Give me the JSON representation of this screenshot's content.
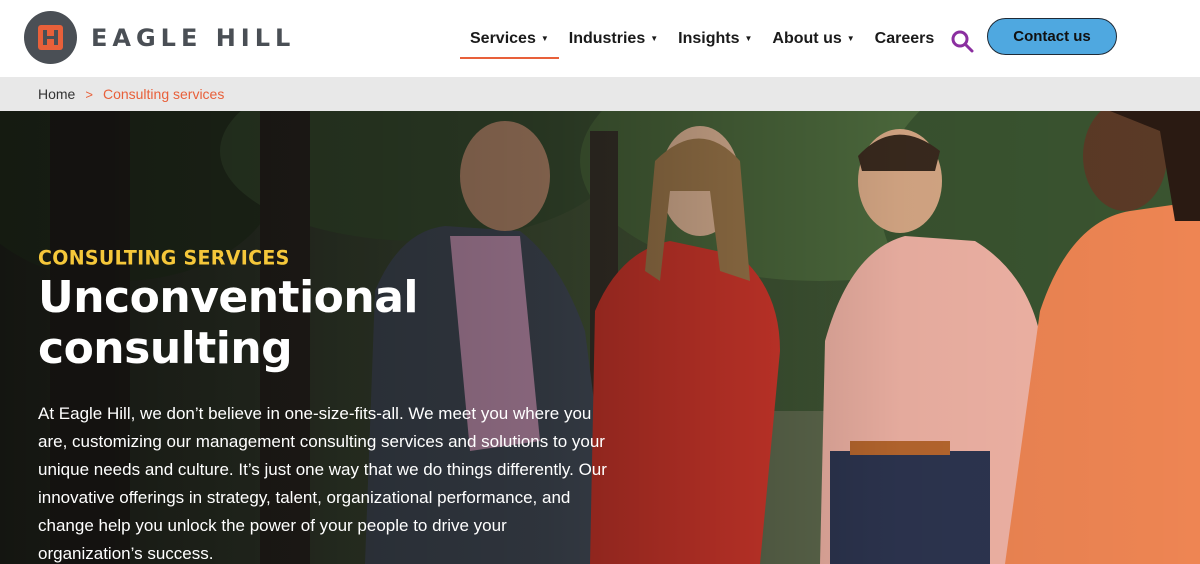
{
  "brand": {
    "name": "EAGLE HILL"
  },
  "nav": {
    "items": [
      {
        "label": "Services",
        "has_caret": true
      },
      {
        "label": "Industries",
        "has_caret": true
      },
      {
        "label": "Insights",
        "has_caret": true
      },
      {
        "label": "About us",
        "has_caret": true
      },
      {
        "label": "Careers",
        "has_caret": false
      }
    ],
    "caret": "▼",
    "search_icon": "search-icon",
    "contact_label": "Contact us"
  },
  "breadcrumb": {
    "home": "Home",
    "separator": ">",
    "current": "Consulting services"
  },
  "hero": {
    "eyebrow": "CONSULTING SERVICES",
    "title": "Unconventional consulting",
    "body": "At Eagle Hill, we don’t believe in one-size-fits-all. We meet you where you are, customizing our management consulting services and solutions to your unique needs and culture. It’s just one way that we do things differently. Our innovative offerings in strategy, talent, organizational performance, and change help you unlock the power of your people to drive your organization’s success."
  },
  "colors": {
    "accent": "#e8603a",
    "eyebrow": "#f5c73a",
    "contact_button": "#4fa8e0",
    "search_icon": "#8b2fa0"
  }
}
